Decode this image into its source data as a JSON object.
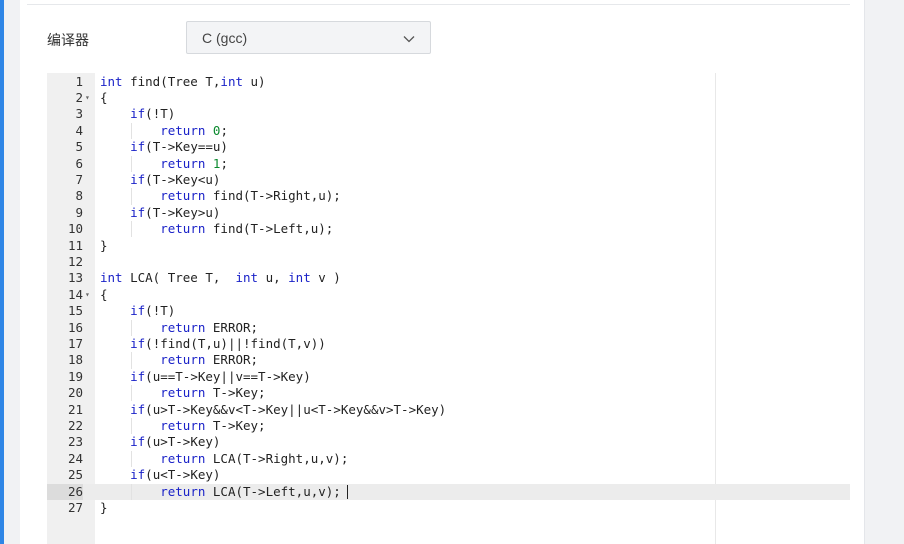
{
  "compiler": {
    "label": "编译器",
    "selected": "C (gcc)",
    "chevron_icon": "chevron-down-icon"
  },
  "editor": {
    "active_line": 26,
    "fold_lines": [
      2,
      14
    ],
    "colors": {
      "keyword": "#1a22c8",
      "number": "#0b8a2e",
      "text": "#222222"
    },
    "lines": [
      [
        {
          "k": "int"
        },
        {
          "t": " find(Tree T,"
        },
        {
          "k": "int"
        },
        {
          "t": " u)"
        }
      ],
      [
        {
          "t": "{"
        }
      ],
      [
        {
          "t": "    "
        },
        {
          "k": "if"
        },
        {
          "t": "(!T)"
        }
      ],
      [
        {
          "t": "        "
        },
        {
          "k": "return"
        },
        {
          "t": " "
        },
        {
          "n": "0"
        },
        {
          "t": ";"
        }
      ],
      [
        {
          "t": "    "
        },
        {
          "k": "if"
        },
        {
          "t": "(T->Key==u)"
        }
      ],
      [
        {
          "t": "        "
        },
        {
          "k": "return"
        },
        {
          "t": " "
        },
        {
          "n": "1"
        },
        {
          "t": ";"
        }
      ],
      [
        {
          "t": "    "
        },
        {
          "k": "if"
        },
        {
          "t": "(T->Key<u)"
        }
      ],
      [
        {
          "t": "        "
        },
        {
          "k": "return"
        },
        {
          "t": " find(T->Right,u);"
        }
      ],
      [
        {
          "t": "    "
        },
        {
          "k": "if"
        },
        {
          "t": "(T->Key>u)"
        }
      ],
      [
        {
          "t": "        "
        },
        {
          "k": "return"
        },
        {
          "t": " find(T->Left,u);"
        }
      ],
      [
        {
          "t": "}"
        }
      ],
      [],
      [
        {
          "k": "int"
        },
        {
          "t": " LCA( Tree T,  "
        },
        {
          "k": "int"
        },
        {
          "t": " u, "
        },
        {
          "k": "int"
        },
        {
          "t": " v )"
        }
      ],
      [
        {
          "t": "{"
        }
      ],
      [
        {
          "t": "    "
        },
        {
          "k": "if"
        },
        {
          "t": "(!T)"
        }
      ],
      [
        {
          "t": "        "
        },
        {
          "k": "return"
        },
        {
          "t": " ERROR;"
        }
      ],
      [
        {
          "t": "    "
        },
        {
          "k": "if"
        },
        {
          "t": "(!find(T,u)||!find(T,v))"
        }
      ],
      [
        {
          "t": "        "
        },
        {
          "k": "return"
        },
        {
          "t": " ERROR;"
        }
      ],
      [
        {
          "t": "    "
        },
        {
          "k": "if"
        },
        {
          "t": "(u==T->Key||v==T->Key)"
        }
      ],
      [
        {
          "t": "        "
        },
        {
          "k": "return"
        },
        {
          "t": " T->Key;"
        }
      ],
      [
        {
          "t": "    "
        },
        {
          "k": "if"
        },
        {
          "t": "(u>T->Key&&v<T->Key||u<T->Key&&v>T->Key)"
        }
      ],
      [
        {
          "t": "        "
        },
        {
          "k": "return"
        },
        {
          "t": " T->Key;"
        }
      ],
      [
        {
          "t": "    "
        },
        {
          "k": "if"
        },
        {
          "t": "(u>T->Key)"
        }
      ],
      [
        {
          "t": "        "
        },
        {
          "k": "return"
        },
        {
          "t": " LCA(T->Right,u,v);"
        }
      ],
      [
        {
          "t": "    "
        },
        {
          "k": "if"
        },
        {
          "t": "(u<T->Key)"
        }
      ],
      [
        {
          "t": "        "
        },
        {
          "k": "return"
        },
        {
          "t": " LCA(T->Left,u,v);"
        }
      ],
      [
        {
          "t": "}"
        }
      ]
    ]
  }
}
